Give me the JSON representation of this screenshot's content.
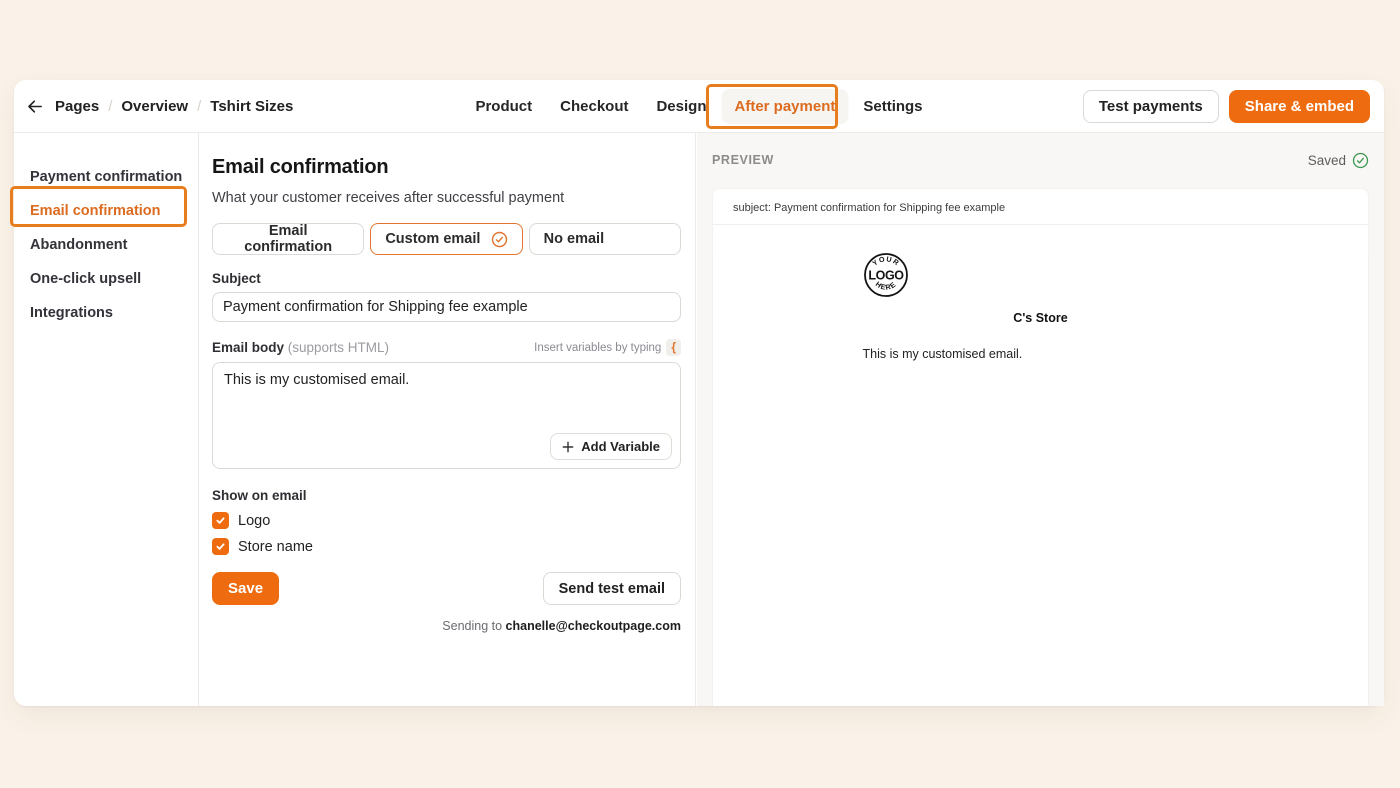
{
  "topbar": {
    "breadcrumb": {
      "items": [
        "Pages",
        "Overview",
        "Tshirt Sizes"
      ],
      "separator": "/"
    },
    "tabs": [
      {
        "label": "Product"
      },
      {
        "label": "Checkout"
      },
      {
        "label": "Design"
      },
      {
        "label": "After payment"
      },
      {
        "label": "Settings"
      }
    ],
    "actions": {
      "test_payments": "Test payments",
      "share_embed": "Share & embed"
    }
  },
  "sidebar": {
    "items": [
      {
        "label": "Payment confirmation"
      },
      {
        "label": "Email confirmation"
      },
      {
        "label": "Abandonment"
      },
      {
        "label": "One-click upsell"
      },
      {
        "label": "Integrations"
      }
    ]
  },
  "main": {
    "title": "Email confirmation",
    "subtitle": "What your customer receives after successful payment",
    "email_mode_options": [
      {
        "label": "Email confirmation"
      },
      {
        "label": "Custom email"
      },
      {
        "label": "No email"
      }
    ],
    "subject": {
      "label": "Subject",
      "value": "Payment confirmation for Shipping fee example"
    },
    "body": {
      "label": "Email body",
      "hint": "(supports HTML)",
      "insert_hint": "Insert variables by typing",
      "insert_symbol": "{",
      "value": "This is my customised email.",
      "add_variable_label": "Add Variable"
    },
    "show_on_email": {
      "label": "Show on email",
      "options": [
        {
          "label": "Logo",
          "checked": true
        },
        {
          "label": "Store name",
          "checked": true
        }
      ]
    },
    "save_label": "Save",
    "send_test_label": "Send test email",
    "sending_to_prefix": "Sending to",
    "sending_to_email": "chanelle@checkoutpage.com"
  },
  "preview": {
    "label": "PREVIEW",
    "saved_label": "Saved",
    "subject_line": "subject: Payment confirmation for Shipping fee example",
    "logo_text": {
      "top": "YOUR",
      "middle": "LOGO",
      "bottom": "HERE"
    },
    "store_name": "C's Store",
    "body_text": "This is my customised email."
  },
  "colors": {
    "accent_orange": "#EE6C0F",
    "active_text_orange": "#DC6B20",
    "annotation_orange": "#E87D1E",
    "saved_green": "#3E9950",
    "page_background": "#FAF2E8"
  }
}
